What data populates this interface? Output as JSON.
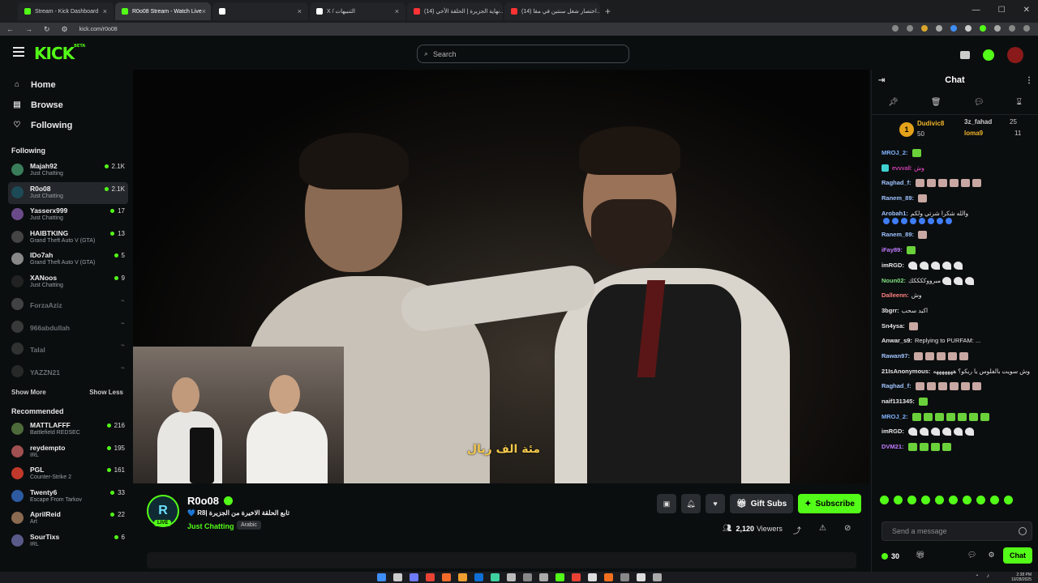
{
  "browser": {
    "tabs": [
      {
        "title": "Stream - Kick Dashboard",
        "color": "#53fc18",
        "active": false
      },
      {
        "title": "R0o08 Stream - Watch Live",
        "color": "#53fc18",
        "active": true
      },
      {
        "title": "",
        "color": "#ffffff",
        "active": false
      },
      {
        "title": "X / التنبيهات",
        "color": "#ffffff",
        "active": false
      },
      {
        "title": "(14) نهاية الجزيرة | الحلقة الأخي...",
        "color": "#ff3333",
        "active": false
      },
      {
        "title": "(14) اختصار شغل سنتين في مقا...",
        "color": "#ff3333",
        "active": false
      }
    ],
    "url": "kick.com/r0o08"
  },
  "header": {
    "logo": "KICK",
    "logo_badge": "BETA",
    "search_placeholder": "Search"
  },
  "sidebar": {
    "nav": [
      {
        "label": "Home",
        "icon": "home-icon"
      },
      {
        "label": "Browse",
        "icon": "browse-icon"
      },
      {
        "label": "Following",
        "icon": "heart-icon"
      }
    ],
    "following_title": "Following",
    "following": [
      {
        "name": "Majah92",
        "category": "Just Chatting",
        "viewers": "2.1K",
        "color": "#3a7d5a",
        "live": true
      },
      {
        "name": "R0o08",
        "category": "Just Chatting",
        "viewers": "2.1K",
        "color": "#1d4a57",
        "live": true,
        "active": true
      },
      {
        "name": "Yasserx999",
        "category": "Just Chatting",
        "viewers": "17",
        "color": "#6b4a8a",
        "live": true
      },
      {
        "name": "HAIBTKING",
        "category": "Grand Theft Auto V (GTA)",
        "viewers": "13",
        "color": "#444",
        "live": true
      },
      {
        "name": "IDo7ah",
        "category": "Grand Theft Auto V (GTA)",
        "viewers": "5",
        "color": "#888",
        "live": true
      },
      {
        "name": "XANoos",
        "category": "Just Chatting",
        "viewers": "9",
        "color": "#222",
        "live": true
      },
      {
        "name": "ForzaAziz",
        "live": false,
        "color": "#777"
      },
      {
        "name": "966abdullah",
        "live": false,
        "color": "#666"
      },
      {
        "name": "Talal",
        "live": false,
        "color": "#555"
      },
      {
        "name": "YAZZN21",
        "live": false,
        "color": "#444"
      }
    ],
    "show_more": "Show More",
    "show_less": "Show Less",
    "recommended_title": "Recommended",
    "recommended": [
      {
        "name": "MATTLAFFF",
        "category": "Battlefield REDSEC",
        "viewers": "216",
        "color": "#4d6b3a"
      },
      {
        "name": "reydempto",
        "category": "IRL",
        "viewers": "195",
        "color": "#a05050"
      },
      {
        "name": "PGL",
        "category": "Counter-Strike 2",
        "viewers": "161",
        "color": "#c0392b"
      },
      {
        "name": "Twenty6",
        "category": "Escape From Tarkov",
        "viewers": "33",
        "color": "#2d5aa0"
      },
      {
        "name": "AprilReid",
        "category": "Art",
        "viewers": "22",
        "color": "#8a6a50"
      },
      {
        "name": "SourTixs",
        "category": "IRL",
        "viewers": "6",
        "color": "#5a5a8a"
      }
    ]
  },
  "video": {
    "subtitle": "مئة الف ريال"
  },
  "stream": {
    "channel_name": "R0o08",
    "avatar_letter": "R",
    "live_label": "LIVE",
    "title": "تابع الحلقة الاخيرة من الجزيرة |R8 💙",
    "category": "Just Chatting",
    "language": "Arabic",
    "gift_label": "Gift Subs",
    "subscribe_label": "Subscribe",
    "viewers": "2,120",
    "viewers_label": "Viewers"
  },
  "chat": {
    "title": "Chat",
    "top_gifters": [
      {
        "rank": "1",
        "name": "Dudivic8",
        "count": "50"
      },
      {
        "name": "3z_fahad",
        "count": "25"
      },
      {
        "name": "loma9",
        "count": "11"
      }
    ],
    "messages": [
      {
        "user": "MROJ_2:",
        "color": "#7fb3ff",
        "text": "",
        "emote": "green",
        "n": 1
      },
      {
        "user": "",
        "color": "#ff4fd8",
        "text": "evvvall: وش",
        "emote": "",
        "n": 0
      },
      {
        "user": "Raghad_f:",
        "color": "#9fc3ff",
        "text": "",
        "emote": "pink",
        "n": 6
      },
      {
        "user": "Ranem_89:",
        "color": "#9fc3ff",
        "text": "",
        "emote": "pink",
        "n": 1
      },
      {
        "user": "Arobah1:",
        "color": "#9fc3ff",
        "text": "والله شكرا شرتي ولكم",
        "emote": "blue",
        "n": 8
      },
      {
        "user": "Ranem_89:",
        "color": "#9fc3ff",
        "text": "",
        "emote": "pink",
        "n": 1
      },
      {
        "user": "iFay89:",
        "color": "#c07bff",
        "text": "",
        "emote": "green",
        "n": 1
      },
      {
        "user": "imRGD:",
        "color": "#e6e6e6",
        "text": "",
        "emote": "white",
        "n": 5
      },
      {
        "user": "Noun02:",
        "color": "#7fe07f",
        "text": "مبرووككككك",
        "emote": "white",
        "n": 3
      },
      {
        "user": "Dalleenn:",
        "color": "#ff8080",
        "text": "وش",
        "emote": "",
        "n": 0
      },
      {
        "user": "3bgrr:",
        "color": "#e6e6e6",
        "text": "اكيد سحب",
        "emote": "",
        "n": 0
      },
      {
        "user": "Sn4ysa:",
        "color": "#e6e6e6",
        "text": "",
        "emote": "pink",
        "n": 1
      },
      {
        "user": "Anwar_s9:",
        "color": "#e6e6e6",
        "text": "Replying to PURFAM: ...",
        "emote": "",
        "n": 0
      },
      {
        "user": "Rawan97:",
        "color": "#9fc3ff",
        "text": "",
        "emote": "pink",
        "n": 5
      },
      {
        "user": "21IsAnonymous:",
        "color": "#e6e6e6",
        "text": "وش سويت بالفلوس يا ريكو؟ هههههههه",
        "emote": "",
        "n": 0
      },
      {
        "user": "Raghad_f:",
        "color": "#9fc3ff",
        "text": "",
        "emote": "pink",
        "n": 6
      },
      {
        "user": "naif131345:",
        "color": "#e6e6e6",
        "text": "",
        "emote": "green",
        "n": 1
      },
      {
        "user": "MROJ_2:",
        "color": "#7fb3ff",
        "text": "",
        "emote": "green",
        "n": 7
      },
      {
        "user": "imRGD:",
        "color": "#e6e6e6",
        "text": "",
        "emote": "white",
        "n": 6
      },
      {
        "user": "DVM21:",
        "color": "#c07bff",
        "text": "",
        "emote": "green",
        "n": 4
      }
    ],
    "input_placeholder": "Send a message",
    "points": "30",
    "chat_button": "Chat"
  },
  "system": {
    "time": "2:38 PM",
    "date": "10/28/2025"
  }
}
